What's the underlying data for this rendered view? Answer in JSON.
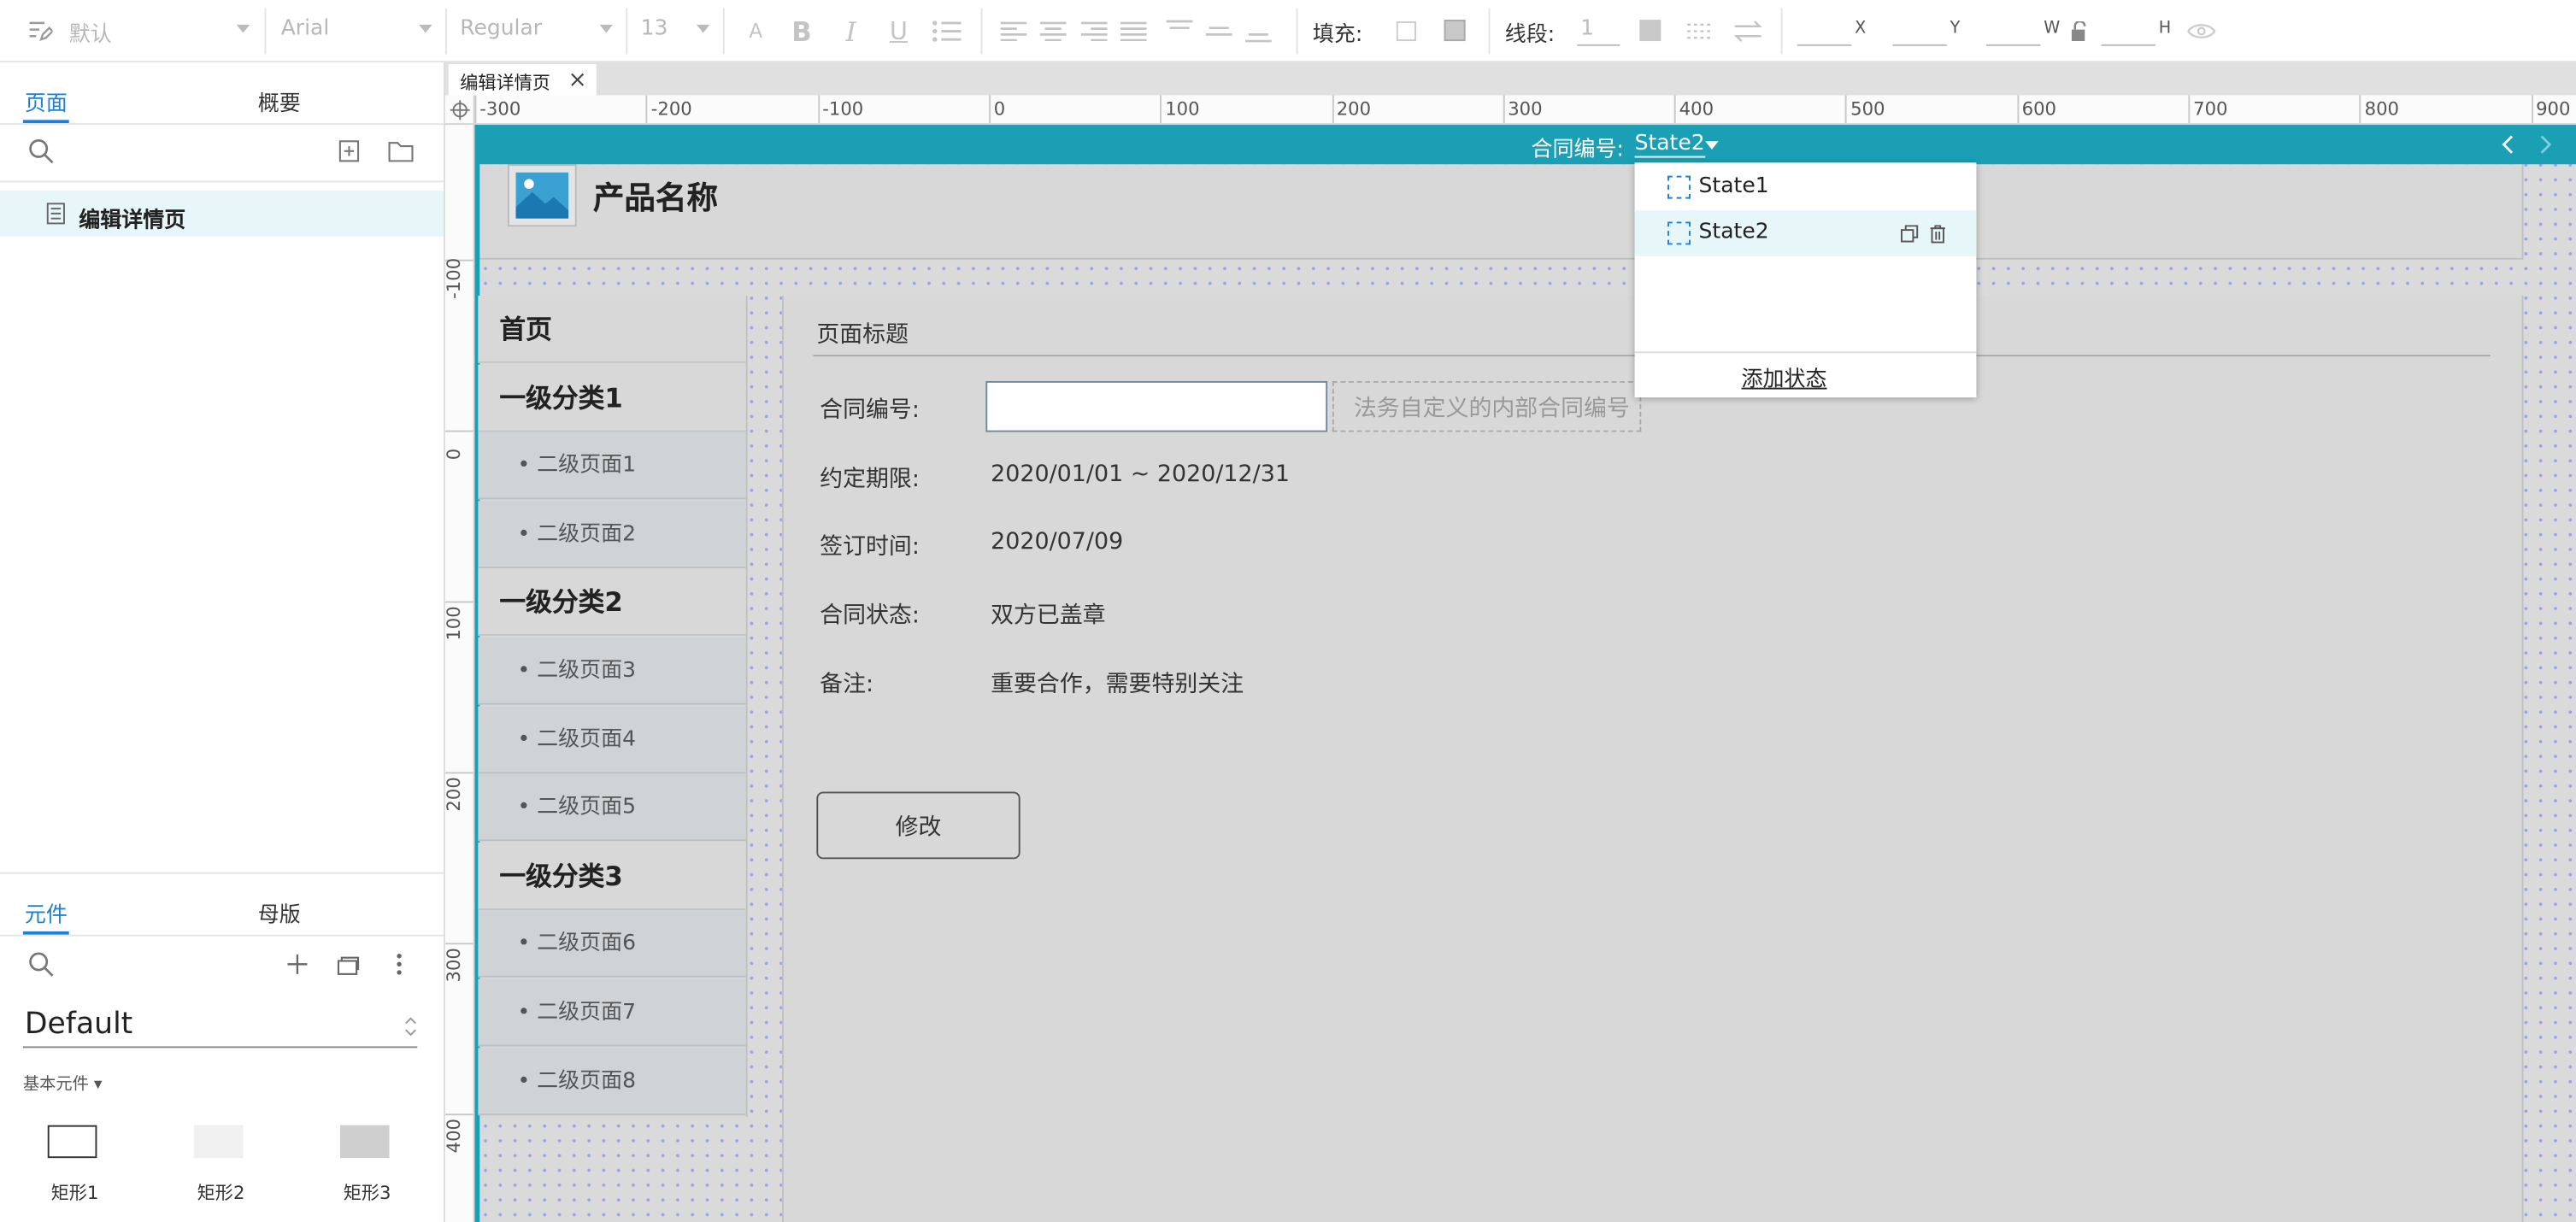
{
  "toolbar": {
    "style_preset": "默认",
    "font_family": "Arial",
    "font_weight": "Regular",
    "font_size": "13",
    "fill_label": "填充:",
    "stroke_label": "线段:",
    "stroke_width": "1",
    "x_label": "X",
    "y_label": "Y",
    "w_label": "W",
    "h_label": "H"
  },
  "left": {
    "tabs": [
      "页面",
      "概要"
    ],
    "page_item": "编辑详情页",
    "lib_tabs": [
      "元件",
      "母版"
    ],
    "library_name": "Default",
    "section_label": "基本元件 ▾",
    "widgets": [
      "矩形1",
      "矩形2",
      "矩形3"
    ]
  },
  "doc_tab": "编辑详情页",
  "ruler": {
    "h_labels": [
      "-300",
      "-200",
      "-100",
      "0",
      "100",
      "200",
      "300",
      "400",
      "500",
      "600",
      "700",
      "800",
      "900"
    ],
    "v_labels": [
      "-100",
      "0",
      "100",
      "200",
      "300",
      "400"
    ]
  },
  "dynamic_panel": {
    "label": "合同编号:",
    "current_state": "State2",
    "states": [
      "State1",
      "State2"
    ],
    "add_state": "添加状态"
  },
  "page": {
    "product_name": "产品名称",
    "nav_main": [
      "首页",
      "一级分类1",
      "一级分类2",
      "一级分类3"
    ],
    "nav_sub": [
      "• 二级页面1",
      "• 二级页面2",
      "• 二级页面3",
      "• 二级页面4",
      "• 二级页面5",
      "• 二级页面6",
      "• 二级页面7",
      "• 二级页面8"
    ],
    "title": "页面标题",
    "fields": [
      {
        "label": "合同编号:",
        "value": ""
      },
      {
        "label": "约定期限:",
        "value": "2020/01/01 ~ 2020/12/31"
      },
      {
        "label": "签订时间:",
        "value": "2020/07/09"
      },
      {
        "label": "合同状态:",
        "value": "双方已盖章"
      },
      {
        "label": "备注:",
        "value": "重要合作，需要特别关注"
      }
    ],
    "contract_hint": "法务自定义的内部合同编号",
    "edit_button": "修改"
  },
  "colors": {
    "accent": "#1a9fb5",
    "tab_active": "#1d80d8",
    "canvas": "#dadada"
  }
}
